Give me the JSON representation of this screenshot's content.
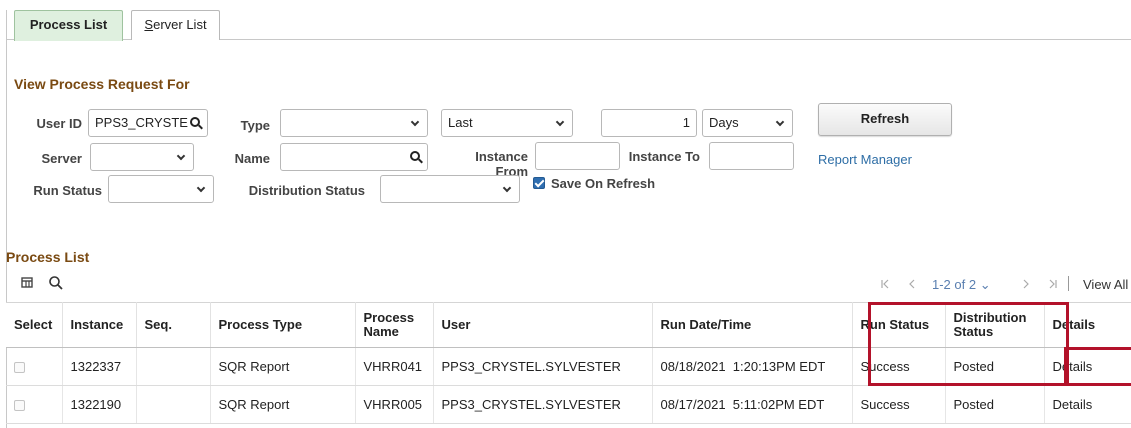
{
  "tabs": [
    {
      "label": "Process List",
      "active": true
    },
    {
      "label": "Server List",
      "underline_char": "S",
      "rest": "erver List",
      "active": false
    }
  ],
  "filter": {
    "section_title": "View Process Request For",
    "user_id_label": "User ID",
    "user_id_value": "PPS3_CRYSTE",
    "type_label": "Type",
    "type_value": "",
    "period_value": "Last",
    "period_count": "1",
    "period_unit": "Days",
    "refresh_label": "Refresh",
    "server_label": "Server",
    "server_value": "",
    "name_label": "Name",
    "name_value": "",
    "instance_from_label": "Instance From",
    "instance_from_value": "",
    "instance_to_label": "Instance To",
    "instance_to_value": "",
    "report_manager_label": "Report Manager",
    "run_status_label": "Run Status",
    "run_status_value": "",
    "distribution_status_label": "Distribution Status",
    "distribution_status_value": "",
    "save_on_refresh_label": "Save On Refresh",
    "save_on_refresh_checked": true
  },
  "process_list": {
    "title": "Process List",
    "pager_text": "1-2 of 2",
    "view_all_label": "View All",
    "columns": [
      "Select",
      "Instance",
      "Seq.",
      "Process Type",
      "Process Name",
      "User",
      "Run Date/Time",
      "Run Status",
      "Distribution Status",
      "Details"
    ],
    "rows": [
      {
        "instance": "1322337",
        "seq": "",
        "process_type": "SQR Report",
        "process_name": "VHRR041",
        "user": "PPS3_CRYSTEL.SYLVESTER",
        "run_datetime": "08/18/2021  1:20:13PM EDT",
        "run_status": "Success",
        "distribution_status": "Posted",
        "details": "Details"
      },
      {
        "instance": "1322190",
        "seq": "",
        "process_type": "SQR Report",
        "process_name": "VHRR005",
        "user": "PPS3_CRYSTEL.SYLVESTER",
        "run_datetime": "08/17/2021  5:11:02PM EDT",
        "run_status": "Success",
        "distribution_status": "Posted",
        "details": "Details"
      }
    ]
  },
  "colors": {
    "active_tab_bg": "#dff0df",
    "section_title": "#7a4a12",
    "link": "#2e6ea6",
    "highlight_box": "#b3122a"
  }
}
